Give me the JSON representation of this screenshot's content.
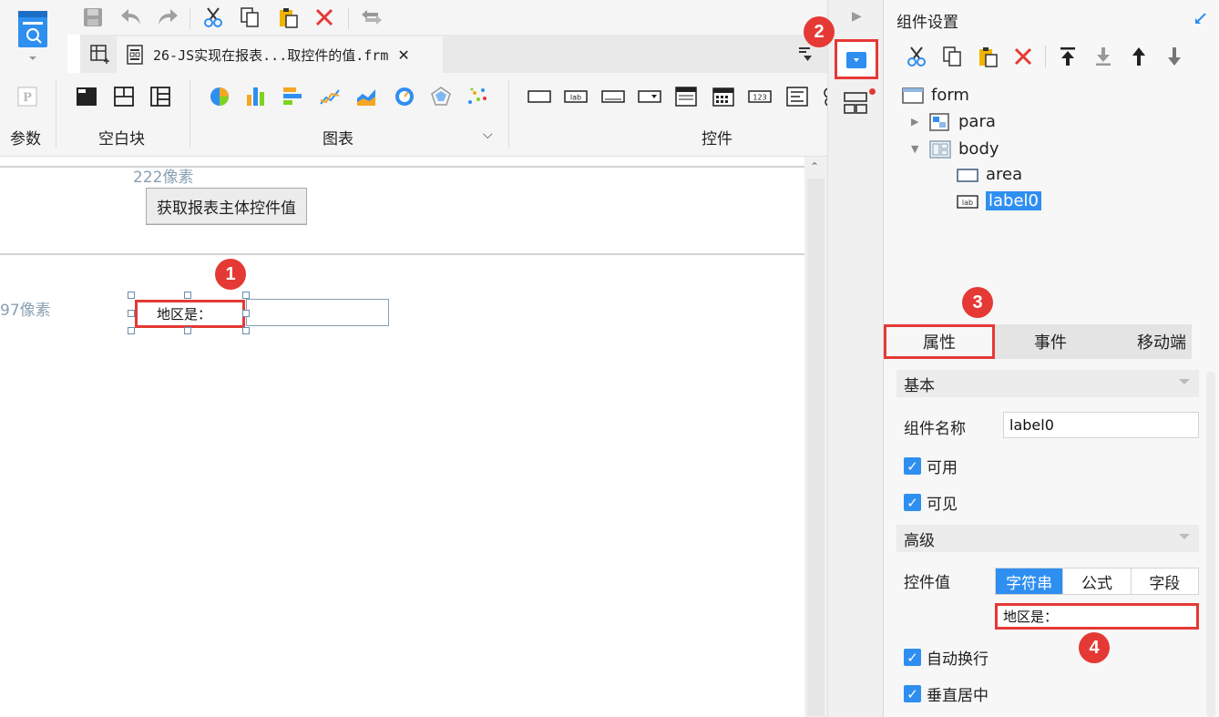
{
  "file_tab": {
    "title": "26-JS实现在报表...取控件的值.frm",
    "close": "✕"
  },
  "ribbon": {
    "groups": {
      "params": "参数",
      "blank": "空白块",
      "chart": "图表",
      "widget": "控件"
    },
    "chart_more": "⌵"
  },
  "canvas": {
    "top_size_label": "222像素",
    "fetch_button": "获取报表主体控件值",
    "body_size_label": "97像素",
    "label_widget_text": "地区是："
  },
  "badges": {
    "b1": "1",
    "b2": "2",
    "b3": "3",
    "b4": "4"
  },
  "panel": {
    "title": "组件设置",
    "tree": [
      {
        "name": "form"
      },
      {
        "name": "para"
      },
      {
        "name": "body"
      },
      {
        "name": "area"
      },
      {
        "name": "label0"
      }
    ],
    "tabs": {
      "props": "属性",
      "events": "事件",
      "mobile": "移动端"
    },
    "sections": {
      "basic": "基本",
      "advanced": "高级"
    },
    "fields": {
      "name_label": "组件名称",
      "name_value": "label0",
      "enabled": "可用",
      "visible": "可见",
      "value_label": "控件值",
      "value_modes": [
        "字符串",
        "公式",
        "字段"
      ],
      "value_text": "地区是：",
      "auto_wrap": "自动换行",
      "vertical_center": "垂直居中"
    }
  },
  "colors": {
    "accent": "#2f8ff0",
    "highlight": "#e53935"
  },
  "icons": [
    "save-icon",
    "undo-icon",
    "redo-icon",
    "cut-icon",
    "copy-icon",
    "paste-icon",
    "delete-icon",
    "swap-icon"
  ]
}
